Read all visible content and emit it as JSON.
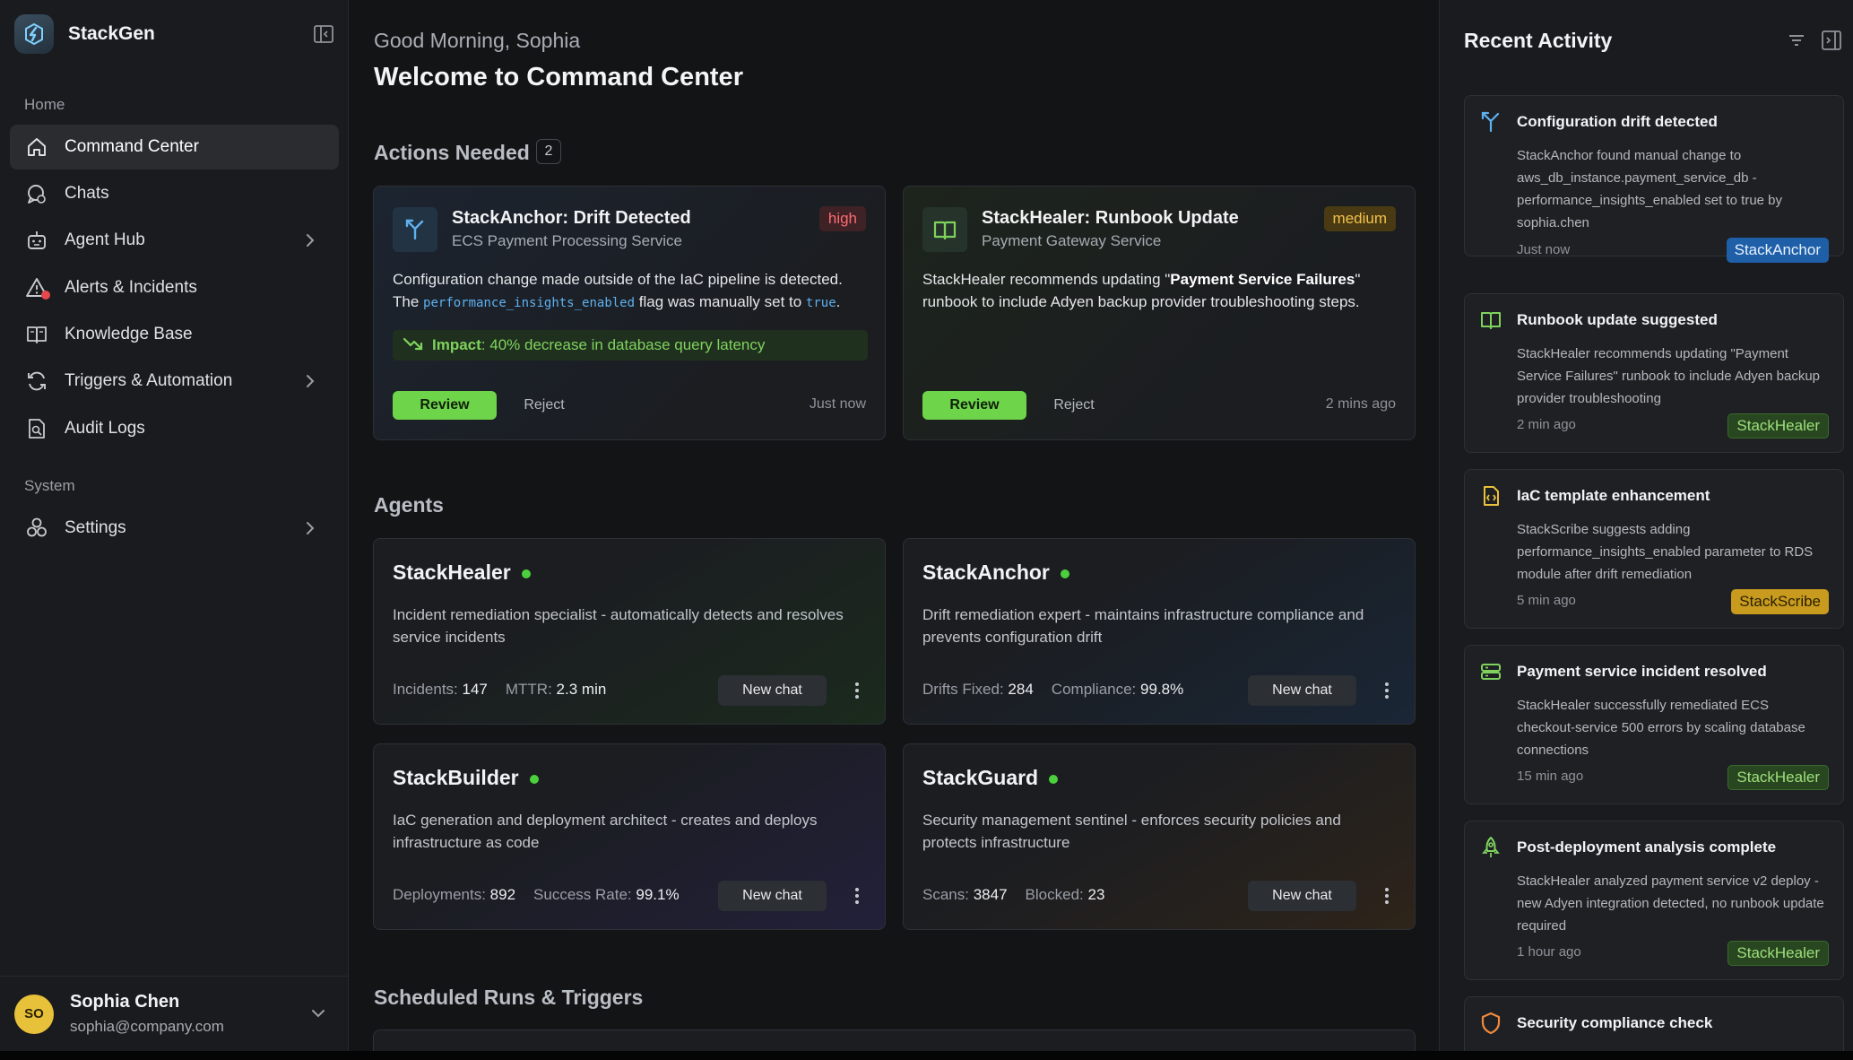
{
  "brand": {
    "name": "StackGen"
  },
  "sidebar": {
    "section_home": "Home",
    "items": [
      {
        "label": "Command Center"
      },
      {
        "label": "Chats"
      },
      {
        "label": "Agent Hub"
      },
      {
        "label": "Alerts & Incidents"
      },
      {
        "label": "Knowledge Base"
      },
      {
        "label": "Triggers & Automation"
      },
      {
        "label": "Audit Logs"
      }
    ],
    "section_system": "System",
    "settings_label": "Settings"
  },
  "user": {
    "initials": "SO",
    "name": "Sophia Chen",
    "email": "sophia@company.com"
  },
  "header": {
    "greeting": "Good Morning, Sophia",
    "title": "Welcome to Command Center"
  },
  "actions": {
    "title": "Actions Needed",
    "count": "2",
    "cards": [
      {
        "title": "StackAnchor: Drift Detected",
        "subtitle": "ECS Payment Processing Service",
        "severity": "high",
        "desc_line1": "Configuration change made outside of the IaC pipeline is detected.",
        "desc_pre": "The ",
        "desc_code": "performance_insights_enabled",
        "desc_mid": " flag was manually set to ",
        "desc_code2": "true",
        "desc_end": ".",
        "impact_label": "Impact",
        "impact_text": ": 40% decrease in database query latency",
        "review": "Review",
        "reject": "Reject",
        "time": "Just now"
      },
      {
        "title": "StackHealer: Runbook Update",
        "subtitle": "Payment Gateway Service",
        "severity": "medium",
        "desc_pre": "StackHealer recommends updating \"",
        "desc_bold": "Payment Service Failures",
        "desc_end": "\" runbook to include Adyen backup provider troubleshooting steps.",
        "review": "Review",
        "reject": "Reject",
        "time": "2 mins ago"
      }
    ]
  },
  "agents": {
    "title": "Agents",
    "new_chat": "New chat",
    "list": [
      {
        "name": "StackHealer",
        "desc": "Incident remediation specialist - automatically detects and resolves service incidents",
        "s1_label": "Incidents:",
        "s1_val": "147",
        "s2_label": "MTTR:",
        "s2_val": "2.3 min"
      },
      {
        "name": "StackAnchor",
        "desc": "Drift remediation expert - maintains infrastructure compliance and prevents configuration drift",
        "s1_label": "Drifts Fixed:",
        "s1_val": "284",
        "s2_label": "Compliance:",
        "s2_val": "99.8%"
      },
      {
        "name": "StackBuilder",
        "desc": "IaC generation and deployment architect - creates and deploys infrastructure as code",
        "s1_label": "Deployments:",
        "s1_val": "892",
        "s2_label": "Success Rate:",
        "s2_val": "99.1%"
      },
      {
        "name": "StackGuard",
        "desc": "Security management sentinel - enforces security policies and protects infrastructure",
        "s1_label": "Scans:",
        "s1_val": "3847",
        "s2_label": "Blocked:",
        "s2_val": "23"
      }
    ]
  },
  "scheduled": {
    "title": "Scheduled Runs & Triggers"
  },
  "activity": {
    "title": "Recent Activity",
    "items": [
      {
        "title": "Configuration drift detected",
        "desc": "StackAnchor found manual change to aws_db_instance.payment_service_db - performance_insights_enabled set to true by sophia.chen",
        "time": "Just now",
        "tag": "StackAnchor"
      },
      {
        "title": "Runbook update suggested",
        "desc": "StackHealer recommends updating \"Payment Service Failures\" runbook to include Adyen backup provider troubleshooting",
        "time": "2 min ago",
        "tag": "StackHealer"
      },
      {
        "title": "IaC template enhancement",
        "desc": "StackScribe suggests adding performance_insights_enabled parameter to RDS module after drift remediation",
        "time": "5 min ago",
        "tag": "StackScribe"
      },
      {
        "title": "Payment service incident resolved",
        "desc": "StackHealer successfully remediated ECS checkout-service 500 errors by scaling database connections",
        "time": "15 min ago",
        "tag": "StackHealer"
      },
      {
        "title": "Post-deployment analysis complete",
        "desc": "StackHealer analyzed payment service v2 deploy - new Adyen integration detected, no runbook update required",
        "time": "1 hour ago",
        "tag": "StackHealer"
      },
      {
        "title": "Security compliance check"
      }
    ]
  },
  "colors": {
    "accent_green": "#6ed44a",
    "online": "#4ccf3d",
    "high": "#ff6b6f",
    "medium": "#f2c14b",
    "link_blue": "#5eb1ef"
  },
  "icons": [
    "stackgen-logo-icon",
    "sidebar-collapse-icon",
    "home-icon",
    "chat-icon",
    "robot-icon",
    "alert-icon",
    "book-icon",
    "automation-icon",
    "audit-log-icon",
    "settings-icon",
    "chevron-right-icon",
    "chevron-down-icon",
    "branch-icon",
    "trend-down-icon",
    "filter-icon",
    "code-file-icon",
    "server-icon",
    "rocket-icon",
    "shield-icon",
    "kebab-icon"
  ]
}
